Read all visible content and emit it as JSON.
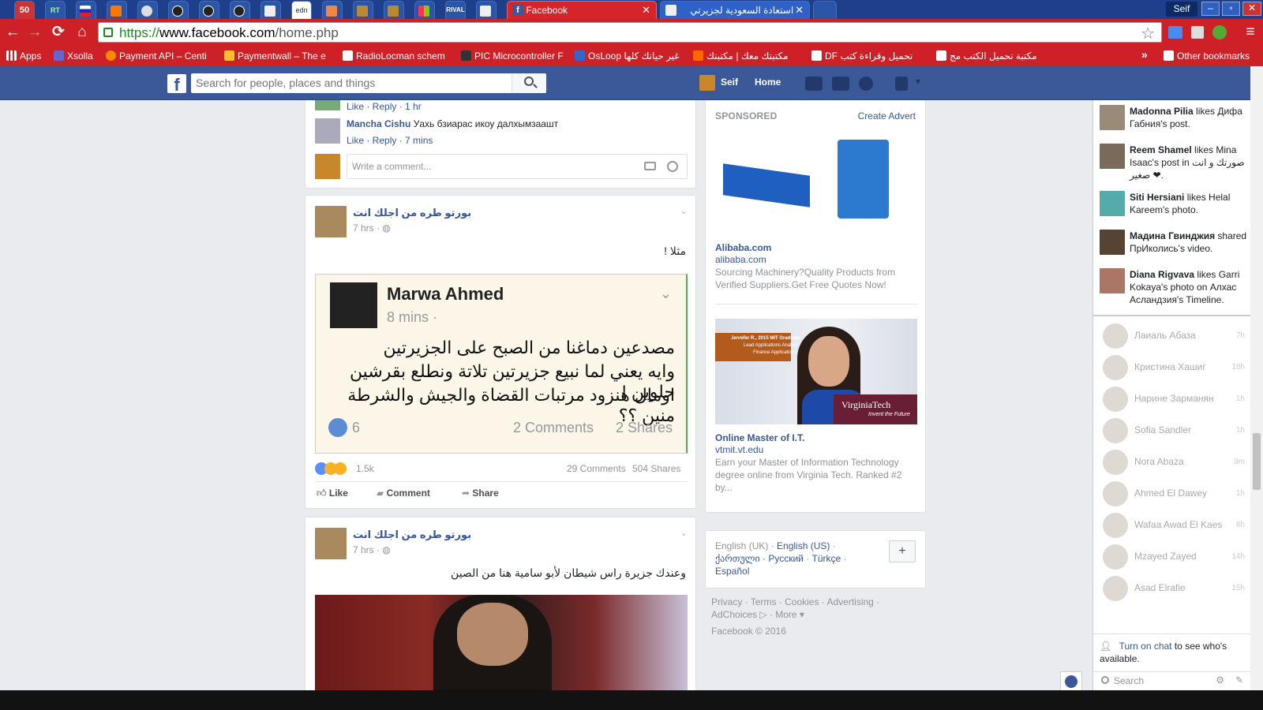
{
  "browser": {
    "tabs": [
      {
        "label": "50",
        "kind": "icon"
      },
      {
        "label": "RT",
        "kind": "icon"
      },
      {
        "label": "",
        "kind": "icon"
      },
      {
        "label": "",
        "kind": "icon"
      },
      {
        "label": "",
        "kind": "icon"
      },
      {
        "label": "",
        "kind": "icon"
      },
      {
        "label": "",
        "kind": "icon"
      },
      {
        "label": "",
        "kind": "icon"
      },
      {
        "label": "",
        "kind": "icon"
      },
      {
        "label": "edn",
        "kind": "icon"
      },
      {
        "label": "",
        "kind": "icon"
      },
      {
        "label": "",
        "kind": "icon"
      },
      {
        "label": "",
        "kind": "icon"
      },
      {
        "label": "",
        "kind": "icon"
      },
      {
        "label": "RIVAL",
        "kind": "icon"
      },
      {
        "label": "",
        "kind": "icon"
      }
    ],
    "active_tab": "Facebook",
    "second_tab": "استعادة السعودية لجزيرتي",
    "profile": "Seif",
    "window_buttons": [
      "–",
      "▫",
      "✕"
    ],
    "url_scheme": "https://",
    "url_host": "www.facebook.com",
    "url_path": "/home.php",
    "bookmarks": [
      "Apps",
      "Xsolla",
      "Payment API – Centi",
      "Paymentwall – The e",
      "RadioLocman schem",
      "PIC Microcontroller F",
      "OsLoop غير حياتك كلها",
      "مكتبتك معك | مكتبتك",
      "DF تحميل وقراءة كتب",
      "مكتبة تحميل الكتب مج"
    ],
    "other_bookmarks": "Other bookmarks",
    "chevron": "»"
  },
  "fb": {
    "search_placeholder": "Search for people, places and things",
    "user": "Seif",
    "home": "Home"
  },
  "feed": {
    "comment1": {
      "actions": "Like · Reply · 1 hr"
    },
    "comment2": {
      "author": "Mancha Cishu",
      "text": "Уахь бзиарас икоу далхымзаашт",
      "actions": "Like · Reply · 7 mins"
    },
    "write_comment": "Write a comment...",
    "post1": {
      "page": "بورتو طره من اجلك انت",
      "time": "7 hrs · ",
      "text": "مثلا !",
      "shot_name": "Marwa Ahmed",
      "shot_time": "8 mins · ",
      "shot_line1": "مصدعين دماغنا من الصبح على الجزيرتين",
      "shot_line2": "وايه يعني لما نبيع جزيرتين تلاتة ونطلع بقرشين حلوين !",
      "shot_line3": "اومال هنزود مرتبات القضاة والجيش والشرطة منين ؟؟",
      "shot_likes": "6",
      "shot_comments": "2 Comments",
      "shot_shares": "2 Shares",
      "reactions": "1.5k",
      "comments": "29 Comments",
      "shares": "504 Shares",
      "like": "Like",
      "comment": "Comment",
      "share": "Share"
    },
    "post2": {
      "page": "بورتو طره من اجلك انت",
      "time": "7 hrs · ",
      "text": "وعندك جزيرة راس شيطان لأبو سامية هنا من الصين"
    }
  },
  "sponsored": {
    "header": "SPONSORED",
    "create": "Create Advert",
    "ad1": {
      "title": "Alibaba.com",
      "url": "alibaba.com",
      "desc": "Sourcing Machinery?Quality Products from Verified Suppliers.Get Free Quotes Now!"
    },
    "ad2": {
      "title": "Online Master of I.T.",
      "url": "vtmit.vt.edu",
      "desc": "Earn your Master of Information Technology degree online from Virginia Tech. Ranked #2 by...",
      "banner_line1": "Jennifer R., 2015 MIT Graduate",
      "banner_line2": "Lead Applications Analyst",
      "banner_line3": "Finance Applications",
      "brand": "VirginiaTech",
      "tagline": "Invent the Future"
    }
  },
  "languages": {
    "line1": "English (UK) · ",
    "current": "English (US)",
    "sep1": " ·",
    "line2a": "ქართული · ",
    "line2b": "Русский",
    "line2c": " · ",
    "line2d": "Türkçe",
    "line2e": " ·",
    "line3": "Español",
    "plus": "+"
  },
  "footer": {
    "line1": "Privacy · Terms · Cookies · Advertising ·",
    "line2": "AdChoices ▷ · More ▾",
    "copyright": "Facebook © 2016"
  },
  "ticker": [
    {
      "name": "Madonna Pilia",
      "text": " likes Дифа Габния's post."
    },
    {
      "name": "Reem Shamel",
      "text": " likes Mina Isaac's post in صورتك و انت صغير ❤."
    },
    {
      "name": "Siti Hersiani",
      "text": " likes Helal Kareem's photo."
    },
    {
      "name": "Мадина Гвинджия",
      "text": " shared ПрИколись's video."
    },
    {
      "name": "Diana Rigvava",
      "text": " likes Garri Kokaya's photo on Алхас Асландзия's Timeline."
    }
  ],
  "chat": [
    {
      "name": "Лаиаль Абаза",
      "time": "7h"
    },
    {
      "name": "Кристина Хашиг",
      "time": "18h"
    },
    {
      "name": "Нарине Зарманян",
      "time": "1h"
    },
    {
      "name": "Sofia Sandler",
      "time": "1h"
    },
    {
      "name": "Nora Abaza",
      "time": "9m"
    },
    {
      "name": "Ahmed El Dawey",
      "time": "1h"
    },
    {
      "name": "Wafaa Awad El Kaes",
      "time": "8h"
    },
    {
      "name": "Mzayed Zayed",
      "time": "14h"
    },
    {
      "name": "Asad Elrafie",
      "time": "15h"
    }
  ],
  "chat_footer": {
    "turn_on": "Turn on chat",
    "rest": " to see who's available.",
    "search": "Search"
  }
}
